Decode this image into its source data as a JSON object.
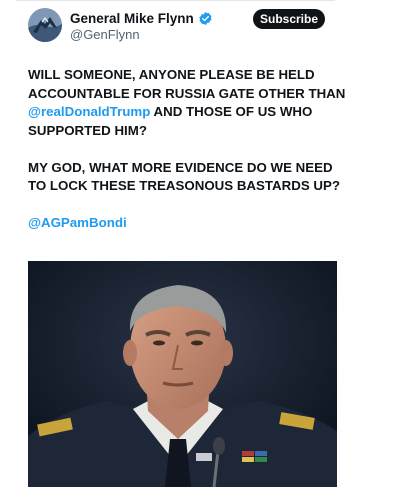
{
  "author": {
    "display_name": "General Mike Flynn",
    "handle": "@GenFlynn",
    "verified": true,
    "verified_color": "#1d9bf0"
  },
  "subscribe_label": "Subscribe",
  "tweet": {
    "p1_a": "WILL SOMEONE, ANYONE PLEASE BE HELD ACCOUNTABLE FOR RUSSIA GATE OTHER THAN ",
    "p1_mention": "@realDonaldTrump",
    "p1_b": " AND THOSE OF US WHO SUPPORTED HIM?",
    "p2": "MY GOD, WHAT MORE EVIDENCE DO WE NEED TO LOCK THESE TREASONOUS BASTARDS UP?",
    "p3_mention": "@AGPamBondi"
  },
  "colors": {
    "text": "#0f1419",
    "secondary": "#536471",
    "link": "#1d9bf0",
    "button_bg": "#0f1419"
  }
}
